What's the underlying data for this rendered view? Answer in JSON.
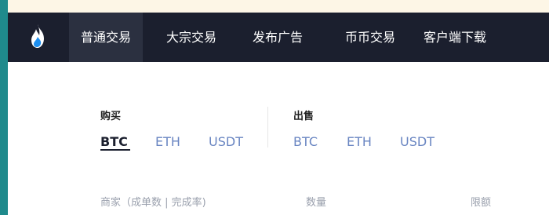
{
  "nav": {
    "items": [
      {
        "label": "普通交易"
      },
      {
        "label": "大宗交易"
      },
      {
        "label": "发布广告"
      },
      {
        "label": "币币交易"
      },
      {
        "label": "客户端下载"
      }
    ]
  },
  "buy": {
    "title": "购买",
    "coins": [
      "BTC",
      "ETH",
      "USDT"
    ]
  },
  "sell": {
    "title": "出售",
    "coins": [
      "BTC",
      "ETH",
      "USDT"
    ]
  },
  "table": {
    "headers": [
      "商家（成单数 | 完成率)",
      "数量",
      "限额"
    ]
  },
  "colors": {
    "navbar": "#1b1f2e",
    "accent_link": "#6a86c2",
    "logo": "#1d8ff0"
  }
}
